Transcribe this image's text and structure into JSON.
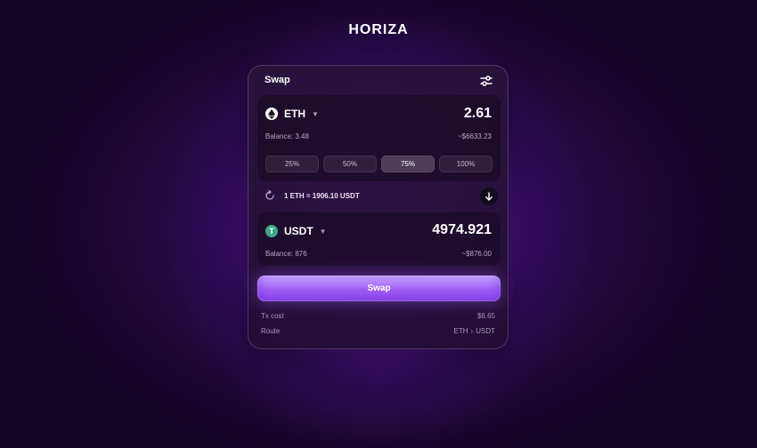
{
  "brand": "HORIZA",
  "card": {
    "title": "Swap",
    "settings_icon": "sliders-icon"
  },
  "from": {
    "token": "ETH",
    "token_icon": "ethereum-logo",
    "amount": "2.61",
    "balance": "Balance: 3.48",
    "usd": "~$6633.23",
    "percent_options": [
      "25%",
      "50%",
      "75%",
      "100%"
    ],
    "selected_percent": "75%"
  },
  "rate": {
    "text": "1 ETH = 1906.10 USDT",
    "icon": "refresh-icon"
  },
  "flip_icon": "arrow-down-icon",
  "to": {
    "token": "USDT",
    "token_icon": "tether-logo",
    "token_glyph": "T",
    "amount": "4974.921",
    "balance": "Balance: 876",
    "usd": "~$876.00"
  },
  "swap_button": "Swap",
  "meta": {
    "tx_cost_label": "Tx cost",
    "tx_cost_value": "$6.65",
    "route_label": "Route",
    "route_from": "ETH",
    "route_sep": "›",
    "route_to": "USDT"
  },
  "colors": {
    "accent": "#a262f6",
    "usdt": "#3aa887"
  }
}
